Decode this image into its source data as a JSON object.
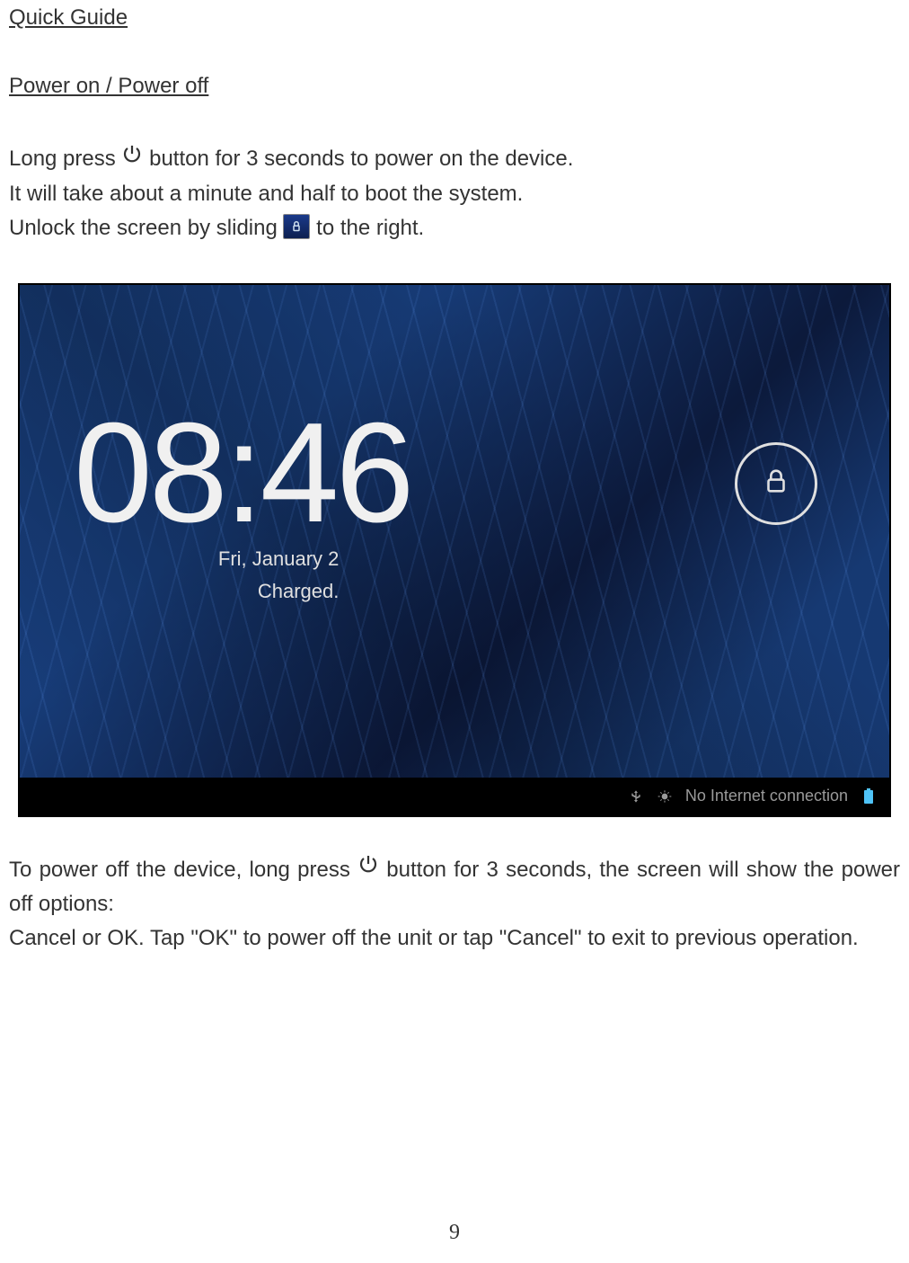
{
  "doc": {
    "title": "Quick Guide",
    "section": "Power on / Power off",
    "para1_a": "Long press ",
    "para1_b": " button for 3 seconds to power on the device.",
    "para2": "It will take about a minute and half to boot the system.",
    "para3_a": "Unlock the screen by sliding ",
    "para3_b": " to the right.",
    "para4_a": "To power off the device, long press ",
    "para4_b": " button for 3 seconds, the screen will show the power off options:",
    "para5": "Cancel  or  OK.   Tap \"OK\" to power off the unit or tap \"Cancel\" to exit to previous operation.",
    "page_number": "9"
  },
  "lockscreen": {
    "time": "08:46",
    "date": "Fri, January 2",
    "status": "Charged.",
    "network": "No Internet connection"
  },
  "icons": {
    "power": "power-icon",
    "unlock_slider": "unlock-slider-icon",
    "lock": "lock-icon",
    "usb": "usb-icon",
    "debug": "debug-icon",
    "battery": "battery-icon"
  }
}
